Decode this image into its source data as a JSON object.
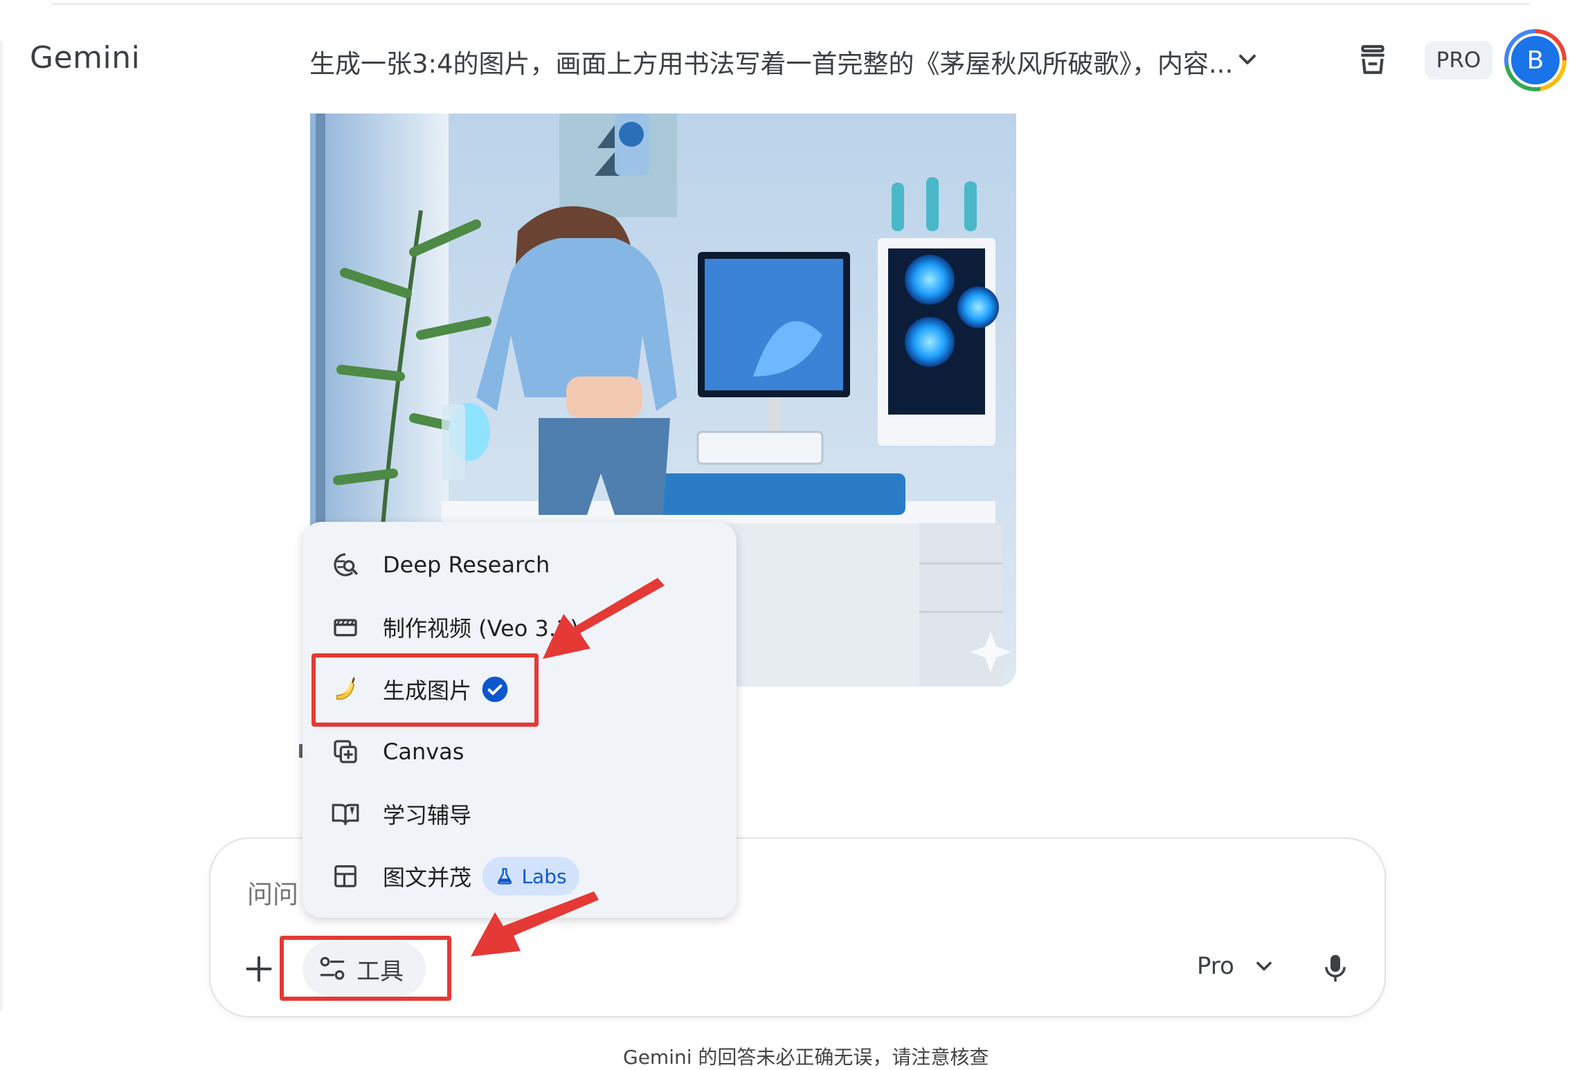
{
  "header": {
    "app_title": "Gemini",
    "chat_title": "生成一张3:4的图片，画面上方用书法写着一首完整的《茅屋秋风所破歌》，内容...",
    "plan_badge": "PRO",
    "avatar_letter": "B"
  },
  "tools_menu": {
    "items": [
      {
        "label": "Deep Research",
        "icon": "deep-research-icon"
      },
      {
        "label": "制作视频 (Veo 3.1)",
        "icon": "clapperboard-icon"
      },
      {
        "label": "生成图片",
        "icon": "banana-icon",
        "selected": true
      },
      {
        "label": "Canvas",
        "icon": "canvas-icon"
      },
      {
        "label": "学习辅导",
        "icon": "book-icon"
      },
      {
        "label": "图文并茂",
        "icon": "layout-icon",
        "chip": "Labs"
      }
    ]
  },
  "input": {
    "placeholder": "问问",
    "tools_label": "工具",
    "model_label": "Pro"
  },
  "footer": {
    "note": "Gemini 的回答未必正确无误，请注意核查"
  },
  "colors": {
    "accent": "#1a73e8",
    "annotation": "#e53935",
    "menu_bg": "#f0f4f9",
    "labs_chip_bg": "#d3e3fd"
  }
}
